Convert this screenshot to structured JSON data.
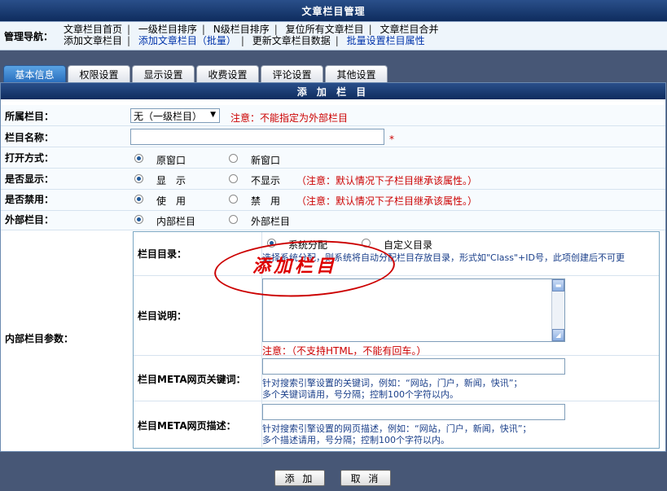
{
  "header": {
    "title": "文章栏目管理"
  },
  "nav": {
    "label": "管理导航：",
    "row1": [
      "文章栏目首页",
      "一级栏目排序",
      "N级栏目排序",
      "复位所有文章栏目",
      "文章栏目合并"
    ],
    "row2": [
      "添加文章栏目",
      "添加文章栏目（批量）",
      "更新文章栏目数据",
      "批量设置栏目属性"
    ]
  },
  "tabs": [
    "基本信息",
    "权限设置",
    "显示设置",
    "收费设置",
    "评论设置",
    "其他设置"
  ],
  "panel": {
    "title": "添 加 栏 目"
  },
  "form": {
    "parent": {
      "label": "所属栏目：",
      "value": "无（一级栏目）",
      "note": "注意：不能指定为外部栏目"
    },
    "name": {
      "label": "栏目名称：",
      "required": "*"
    },
    "open_mode": {
      "label": "打开方式：",
      "opt1": "原窗口",
      "opt2": "新窗口"
    },
    "visible": {
      "label": "是否显示：",
      "opt1": "显　示",
      "opt2": "不显示",
      "note": "（注意：默认情况下子栏目继承该属性。）"
    },
    "disabled": {
      "label": "是否禁用：",
      "opt1": "使　用",
      "opt2": "禁　用",
      "note": "（注意：默认情况下子栏目继承该属性。）"
    },
    "external": {
      "label": "外部栏目：",
      "opt1": "内部栏目",
      "opt2": "外部栏目"
    },
    "internal_params": {
      "label": "内部栏目参数："
    },
    "dir": {
      "label": "栏目目录：",
      "opt1": "系统分配",
      "opt2": "自定义目录",
      "hint": "选择系统分配，则系统将自动分配栏目存放目录，形式如\"Class\"+ID号，此项创建后不可更"
    },
    "desc": {
      "label": "栏目说明：",
      "note": "注意：（不支持HTML，不能有回车。）"
    },
    "meta_kw": {
      "label": "栏目META网页关键词：",
      "hint1": "针对搜索引擎设置的关键词，例如：“网站，门户，新闻，快讯”；",
      "hint2": "多个关键词请用，号分隔；控制100个字符以内。"
    },
    "meta_desc": {
      "label": "栏目META网页描述：",
      "hint1": "针对搜索引擎设置的网页描述，例如：“网站，门户，新闻，快讯”；",
      "hint2": "多个描述请用，号分隔；控制100个字符以内。"
    }
  },
  "stamp": "添加栏目",
  "buttons": {
    "add": "添 加",
    "cancel": "取 消"
  }
}
